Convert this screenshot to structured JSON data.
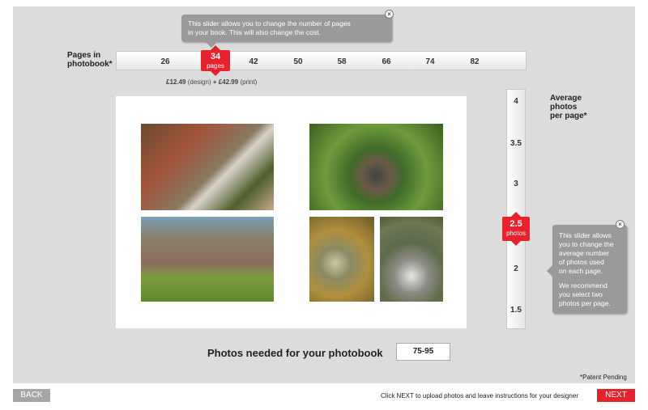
{
  "pages_slider": {
    "label_line1": "Pages in",
    "label_line2": "photobook*",
    "ticks": [
      "26",
      "42",
      "50",
      "58",
      "66",
      "74",
      "82"
    ],
    "selected_value": "34",
    "selected_unit": "pages",
    "price_design": "£12.49",
    "price_design_note": "(design)",
    "price_print": "+ £42.99",
    "price_print_note": "(print)"
  },
  "top_tooltip": {
    "line1": "This slider allows you to change the number of pages",
    "line2": "in your book. This will also change the cost."
  },
  "photos_slider": {
    "label_line1": "Average",
    "label_line2": "photos",
    "label_line3": "per page*",
    "ticks": [
      "4",
      "3.5",
      "3",
      "2",
      "1.5"
    ],
    "selected_value": "2.5",
    "selected_unit": "photos"
  },
  "right_tooltip": {
    "para1_lines": [
      "This slider allows",
      "you to change the",
      "average number",
      "of photos used",
      "on each page."
    ],
    "para2_lines": [
      "We recommend",
      "you select two",
      "photos per page."
    ]
  },
  "photos_needed": {
    "label": "Photos needed for your photobook",
    "value": "75-95"
  },
  "patent": "*Patent Pending",
  "footer": {
    "back_label": "BACK",
    "instruction": "Click NEXT to upload photos and leave instructions for your designer",
    "next_label": "NEXT"
  },
  "colors": {
    "accent": "#e8222a",
    "panel": "#dcdcdc",
    "tooltip": "#9a9a9a"
  }
}
